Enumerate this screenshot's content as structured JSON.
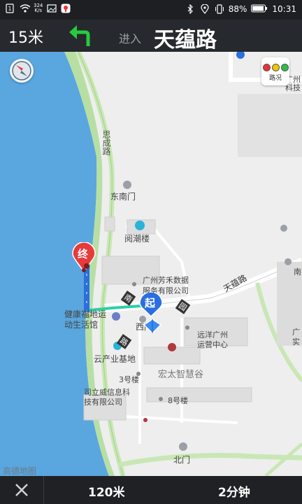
{
  "status_bar": {
    "speed_value": "324",
    "speed_unit": "K/s",
    "battery": "88%",
    "time": "10:31"
  },
  "navigation": {
    "distance": "15米",
    "turn_icon": "turn-left-arrow-icon",
    "enter_label": "进入",
    "road_name": "天蕴路",
    "accent_color": "#27c93f"
  },
  "map": {
    "labels": {
      "sicheng_road": "思成路",
      "south_east_gate": "东南门",
      "yuechao_building": "阅潮楼",
      "guangzhou_fanghe_line1": "广州芳禾数据",
      "guangzhou_fanghe_line2": "服务有限公司",
      "tianyun_road": "天蕴路",
      "health_center_line1": "健康福地运",
      "health_center_line2": "动生活馆",
      "west_gate": "西门",
      "yuanyang_line1": "远洋广州",
      "yuanyang_line2": "运营中心",
      "cloud_base": "云产业基地",
      "hongtai": "宏太智慧谷",
      "building_3": "3号楼",
      "siliwei_line1": "司立威信息科",
      "siliwei_line2": "技有限公司",
      "building_8": "8号楼",
      "north_gate": "北门",
      "right_edge_tech": "广州科技",
      "right_edge_south": "南",
      "right_edge_guang": "广",
      "right_edge_shi": "实"
    },
    "compass_icon": "compass-icon",
    "traffic_label": "路况",
    "end_marker_label": "终",
    "start_marker_label": "起",
    "road_badge_south": "南",
    "road_badge_yun": "园",
    "road_badge_lu": "路",
    "watermark": "高德地图",
    "water_color": "#5aa6de",
    "route_color": "#2a6fe0"
  },
  "bottom_bar": {
    "remaining_distance": "120米",
    "remaining_time": "2分钟"
  }
}
